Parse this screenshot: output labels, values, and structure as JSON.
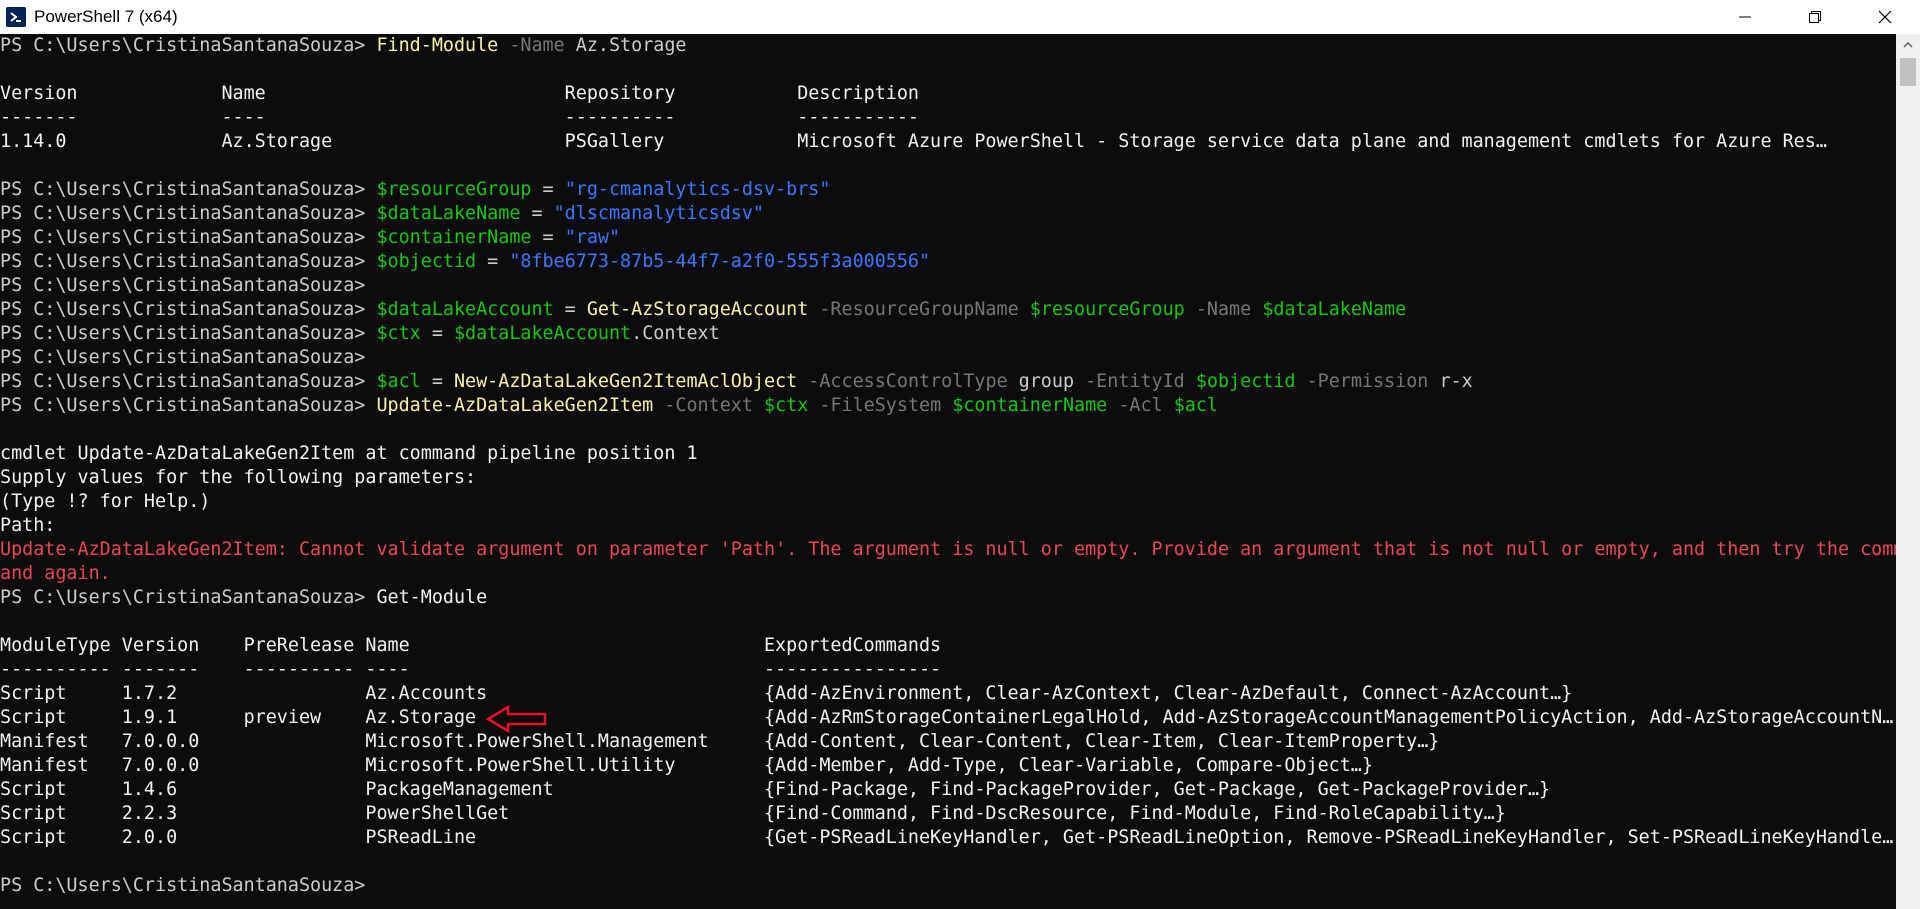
{
  "window": {
    "title": "PowerShell 7 (x64)",
    "app_icon": "powershell-icon",
    "controls": [
      "minimize-icon",
      "maximize-icon",
      "close-icon"
    ]
  },
  "colors": {
    "background": "#0c0c0c",
    "command": "#f9f1a5",
    "parameter": "#767676",
    "variable": "#16c60c",
    "string": "#3b78ff",
    "error": "#e74856",
    "annotation_arrow": "#e81123"
  },
  "prompt": "PS C:\\Users\\CristinaSantanaSouza> ",
  "terminal": {
    "l1": {
      "cmd": "Find-Module",
      "p1": " -Name",
      "a1": " Az.Storage"
    },
    "find_table": {
      "header": "Version             Name                           Repository           Description",
      "sep": "-------             ----                           ----------           -----------",
      "row": "1.14.0              Az.Storage                     PSGallery            Microsoft Azure PowerShell - Storage service data plane and management cmdlets for Azure Res…"
    },
    "l4": {
      "v": "$resourceGroup",
      "op": " = ",
      "s": "\"rg-cmanalytics-dsv-brs\""
    },
    "l5": {
      "v": "$dataLakeName",
      "op": " = ",
      "s": "\"dlscmanalyticsdsv\""
    },
    "l6": {
      "v": "$containerName",
      "op": " = ",
      "s": "\"raw\""
    },
    "l7": {
      "v": "$objectid",
      "op": " = ",
      "s": "\"8fbe6773-87b5-44f7-a2f0-555f3a000556\""
    },
    "l9": {
      "v": "$dataLakeAccount",
      "op": " = ",
      "cmd": "Get-AzStorageAccount",
      "p1": " -ResourceGroupName",
      "v1": " $resourceGroup",
      "p2": " -Name",
      "v2": " $dataLakeName"
    },
    "l10": {
      "v": "$ctx",
      "op": " = ",
      "v1": "$dataLakeAccount",
      "t": ".Context"
    },
    "l12": {
      "v": "$acl",
      "op": " = ",
      "cmd": "New-AzDataLakeGen2ItemAclObject",
      "p1": " -AccessControlType",
      "a1": " group",
      "p2": " -EntityId",
      "v1": " $objectid",
      "p3": " -Permission",
      "a2": " r-x"
    },
    "l13": {
      "cmd": "Update-AzDataLakeGen2Item",
      "p1": " -Context",
      "v1": " $ctx",
      "p2": " -FileSystem",
      "v2": " $containerName",
      "p3": " -Acl",
      "v3": " $acl"
    },
    "cmdlet_msg": "cmdlet Update-AzDataLakeGen2Item at command pipeline position 1",
    "supply_msg": "Supply values for the following parameters:",
    "help_msg": "(Type !? for Help.)",
    "path_msg": "Path:",
    "error_line1": "Update-AzDataLakeGen2Item: Cannot validate argument on parameter 'Path'. The argument is null or empty. Provide an argument that is not null or empty, and then try the comm",
    "error_line2": "and again.",
    "getmodule_cmd": "Get-Module",
    "module_table": {
      "header": "ModuleType Version    PreRelease Name                                ExportedCommands",
      "sep": "---------- -------    ---------- ----                                ----------------",
      "rows": [
        "Script     1.7.2                 Az.Accounts                         {Add-AzEnvironment, Clear-AzContext, Clear-AzDefault, Connect-AzAccount…}",
        "Script     1.9.1      preview    Az.Storage                          {Add-AzRmStorageContainerLegalHold, Add-AzStorageAccountManagementPolicyAction, Add-AzStorageAccountN…",
        "Manifest   7.0.0.0               Microsoft.PowerShell.Management     {Add-Content, Clear-Content, Clear-Item, Clear-ItemProperty…}",
        "Manifest   7.0.0.0               Microsoft.PowerShell.Utility        {Add-Member, Add-Type, Clear-Variable, Compare-Object…}",
        "Script     1.4.6                 PackageManagement                   {Find-Package, Find-PackageProvider, Get-Package, Get-PackageProvider…}",
        "Script     2.2.3                 PowerShellGet                       {Find-Command, Find-DscResource, Find-Module, Find-RoleCapability…}",
        "Script     2.0.0                 PSReadLine                          {Get-PSReadLineKeyHandler, Get-PSReadLineOption, Remove-PSReadLineKeyHandler, Set-PSReadLineKeyHandle…"
      ]
    }
  }
}
